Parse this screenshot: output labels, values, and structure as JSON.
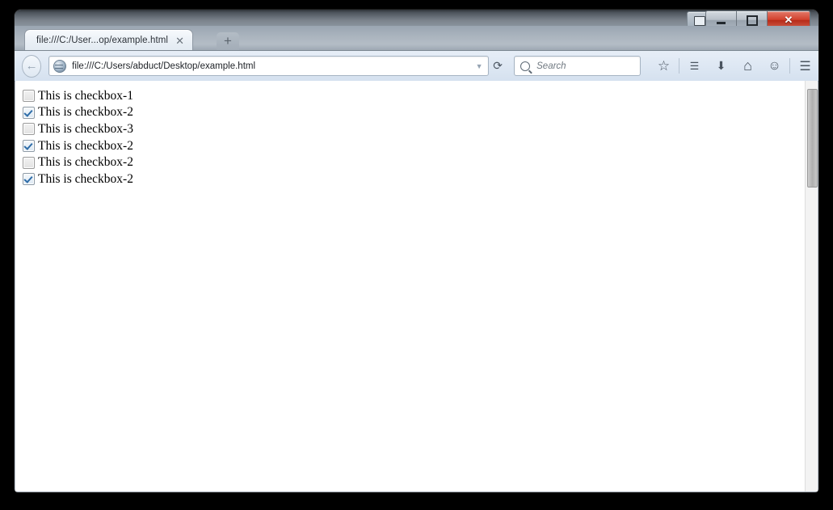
{
  "window": {
    "titlebar": {
      "window_switcher_icon": "window-switcher-icon",
      "minimize_label": "Minimize",
      "maximize_label": "Maximize",
      "close_label": "✕"
    }
  },
  "tabstrip": {
    "tabs": [
      {
        "title": "file:///C:/User...op/example.html",
        "close_glyph": "✕",
        "active": true
      }
    ],
    "new_tab_label": "+"
  },
  "navbar": {
    "back_glyph": "←",
    "url": "file:///C:/Users/abduct/Desktop/example.html",
    "url_dropdown_glyph": "▼",
    "reload_glyph": "⟳",
    "search_placeholder": "Search",
    "search_value": "",
    "buttons": [
      {
        "name": "bookmark-star-icon",
        "glyph": "☆"
      },
      {
        "name": "reader-list-icon",
        "glyph": "☰"
      },
      {
        "name": "download-icon",
        "glyph": "⬇"
      },
      {
        "name": "home-icon",
        "glyph": "⌂"
      },
      {
        "name": "feedback-smiley-icon",
        "glyph": "☺"
      },
      {
        "name": "hamburger-menu-icon",
        "glyph": "☰"
      }
    ]
  },
  "content": {
    "checkboxes": [
      {
        "label": "This is checkbox-1",
        "checked": false
      },
      {
        "label": "This is checkbox-2",
        "checked": true
      },
      {
        "label": "This is checkbox-3",
        "checked": false
      },
      {
        "label": "This is checkbox-2",
        "checked": true
      },
      {
        "label": "This is checkbox-2",
        "checked": false
      },
      {
        "label": "This is checkbox-2",
        "checked": true
      }
    ]
  },
  "colors": {
    "page_background": "#ffffff",
    "desktop_background": "#000000",
    "toolbar": "#dde7f3",
    "tabstrip": "#a9b3bd",
    "close_button": "#d2402c",
    "check_mark": "#2e6ca8",
    "text": "#000000"
  }
}
